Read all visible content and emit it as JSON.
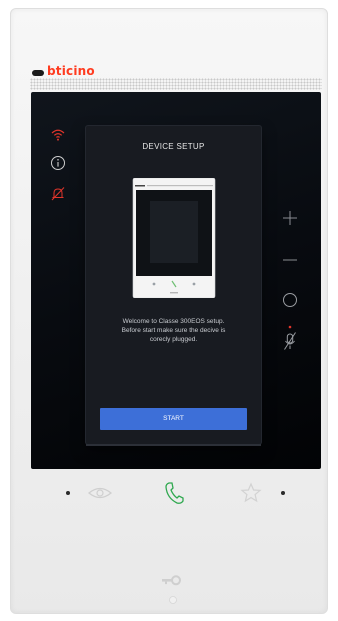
{
  "brand": {
    "name": "bticino",
    "accent_color": "#ff3b1f"
  },
  "status_icons": [
    {
      "icon": "wifi-icon",
      "color": "#e0352b"
    },
    {
      "icon": "info-icon",
      "color": "#cfcfcf"
    },
    {
      "icon": "bell-off-icon",
      "color": "#e0352b"
    }
  ],
  "side_controls": [
    {
      "icon": "plus-icon"
    },
    {
      "icon": "minus-icon"
    },
    {
      "icon": "circle-icon"
    },
    {
      "icon": "mic-off-icon"
    }
  ],
  "dialog": {
    "title": "DEVICE SETUP",
    "welcome_lines": [
      "Welcome to Classe 300EOS setup.",
      "Before start make sure the decive is",
      "corecly plugged."
    ],
    "start_label": "START",
    "button_color": "#3d6fd8"
  },
  "physical_buttons": [
    {
      "icon": "eye-icon"
    },
    {
      "icon": "phone-icon",
      "color": "#2fa84f"
    },
    {
      "icon": "star-icon"
    },
    {
      "icon": "key-icon"
    }
  ]
}
